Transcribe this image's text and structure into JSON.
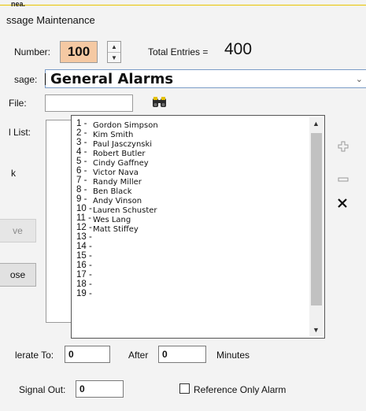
{
  "title": "ssage Maintenance",
  "top_strip_text": "nea.",
  "fields": {
    "number_label": "Number:",
    "number_value": "100",
    "total_label": "Total Entries =",
    "total_value": "400",
    "message_label": "sage:",
    "message_value": "General Alarms",
    "file_label": "File:",
    "list_label": "l List:",
    "k_label": "k"
  },
  "list_items": [
    {
      "n": "1 -",
      "name": "Gordon Simpson"
    },
    {
      "n": "2 -",
      "name": "Kim Smith"
    },
    {
      "n": "3 -",
      "name": "Paul Jasczynski"
    },
    {
      "n": "4 -",
      "name": "Robert Butler"
    },
    {
      "n": "5 -",
      "name": "Cindy Gaffney"
    },
    {
      "n": "6 -",
      "name": "Victor Nava"
    },
    {
      "n": "7 -",
      "name": "Randy Miller"
    },
    {
      "n": "8 -",
      "name": "Ben Black"
    },
    {
      "n": "9 -",
      "name": "Andy Vinson"
    },
    {
      "n": "10 -",
      "name": "Lauren Schuster"
    },
    {
      "n": "11 -",
      "name": "Wes Lang"
    },
    {
      "n": "12 -",
      "name": "Matt Stiffey"
    },
    {
      "n": "13 -",
      "name": ""
    },
    {
      "n": "14 -",
      "name": ""
    },
    {
      "n": "15 -",
      "name": ""
    },
    {
      "n": "16 -",
      "name": ""
    },
    {
      "n": "17 -",
      "name": ""
    },
    {
      "n": "18 -",
      "name": ""
    },
    {
      "n": "19 -",
      "name": ""
    }
  ],
  "buttons": {
    "move": "ve",
    "close": "ose"
  },
  "escalate": {
    "label": "lerate To:",
    "value": "0",
    "after_label": "After",
    "after_value": "0",
    "minutes_label": "Minutes"
  },
  "signal": {
    "label": "Signal Out:",
    "value": "0",
    "reference_label": "Reference Only Alarm"
  },
  "icons": {
    "add": "plus-icon",
    "remove": "minus-icon",
    "delete": "x-icon",
    "browse": "binoculars-icon"
  }
}
